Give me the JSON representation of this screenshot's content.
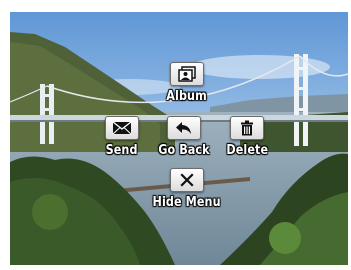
{
  "menu": {
    "album_label": "Album",
    "send_label": "Send",
    "go_back_label": "Go Back",
    "delete_label": "Delete",
    "hide_menu_label": "Hide Menu"
  },
  "icons": {
    "album": "photo-album-icon",
    "send": "envelope-icon",
    "go_back": "back-arrow-icon",
    "delete": "trash-icon",
    "hide_menu": "close-x-icon"
  }
}
